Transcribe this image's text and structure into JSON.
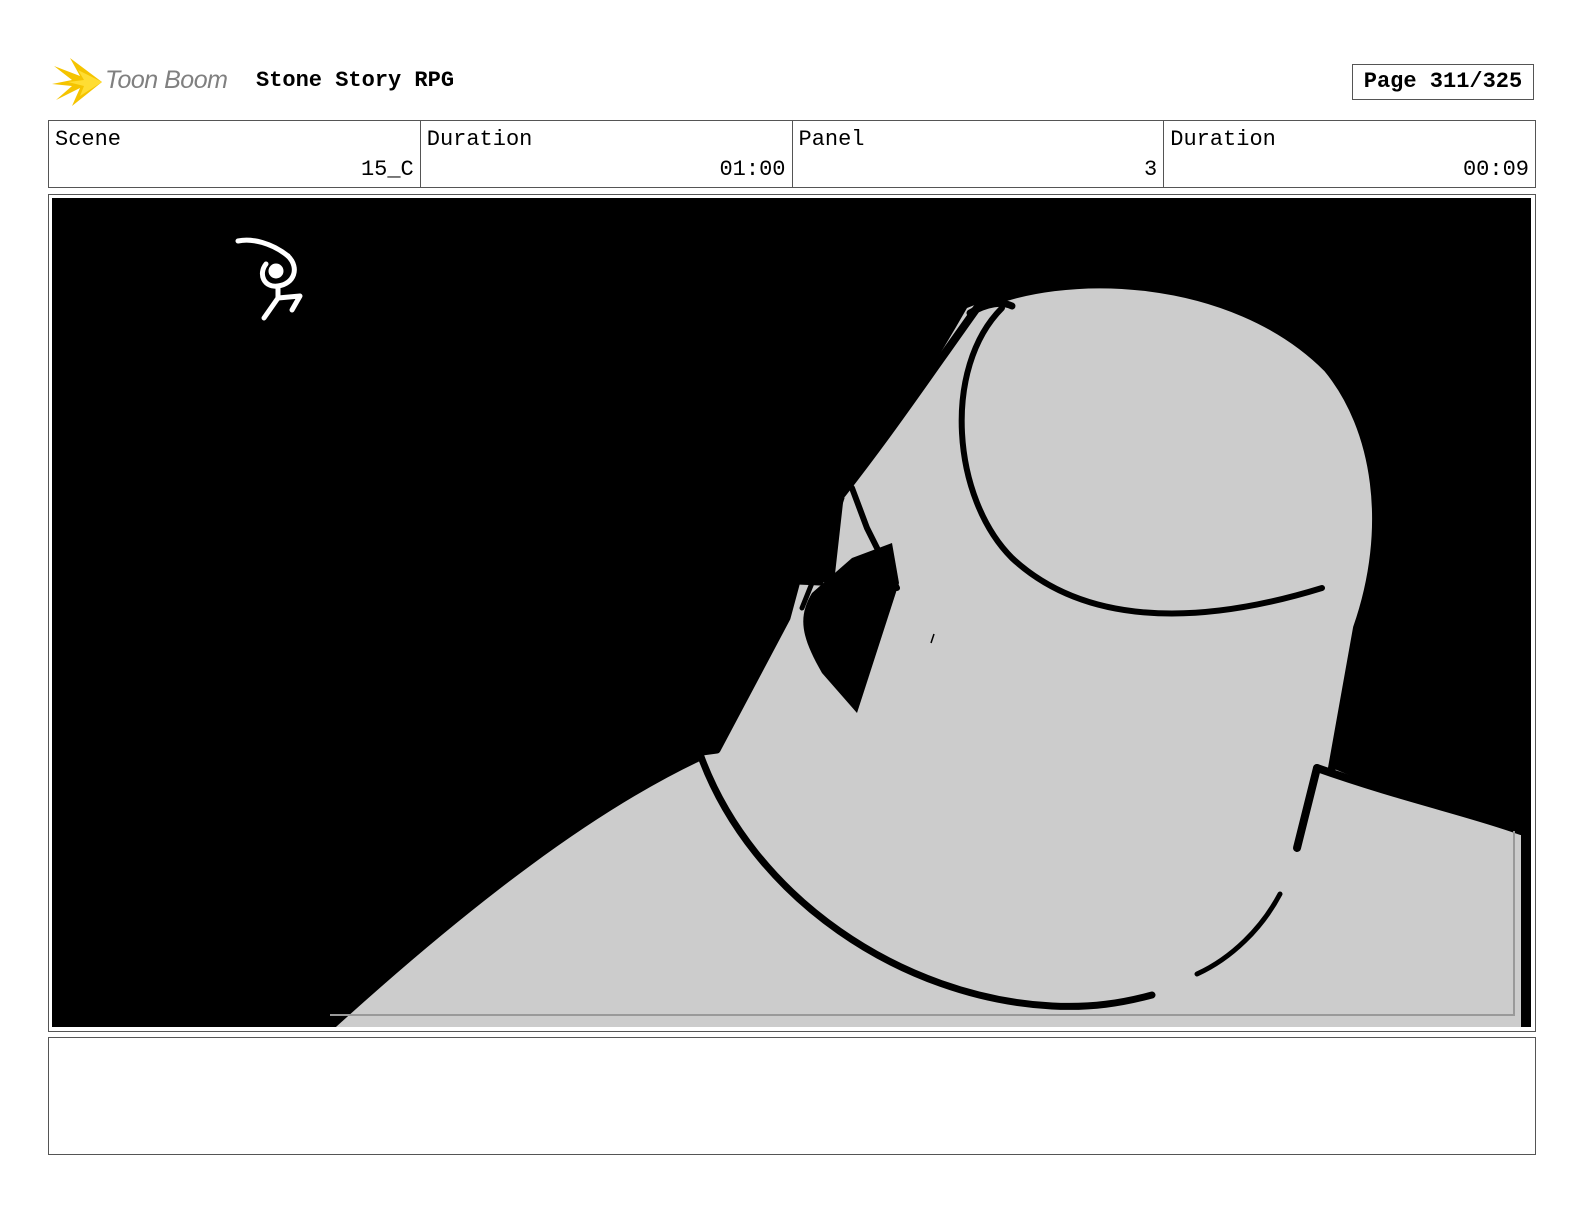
{
  "header": {
    "logo_text": "Toon Boom",
    "logo_icon": "starburst-logo-icon",
    "project_title": "Stone Story RPG",
    "page_label": "Page 311/325"
  },
  "info": {
    "scene_label": "Scene",
    "scene_value": "15_C",
    "scene_duration_label": "Duration",
    "scene_duration_value": "01:00",
    "panel_label": "Panel",
    "panel_value": "3",
    "panel_duration_label": "Duration",
    "panel_duration_value": "00:09"
  },
  "colors": {
    "background": "#000000",
    "figure_fill": "#cccccc",
    "ink": "#000000",
    "logo_yellow": "#f5c400"
  },
  "notes": ""
}
